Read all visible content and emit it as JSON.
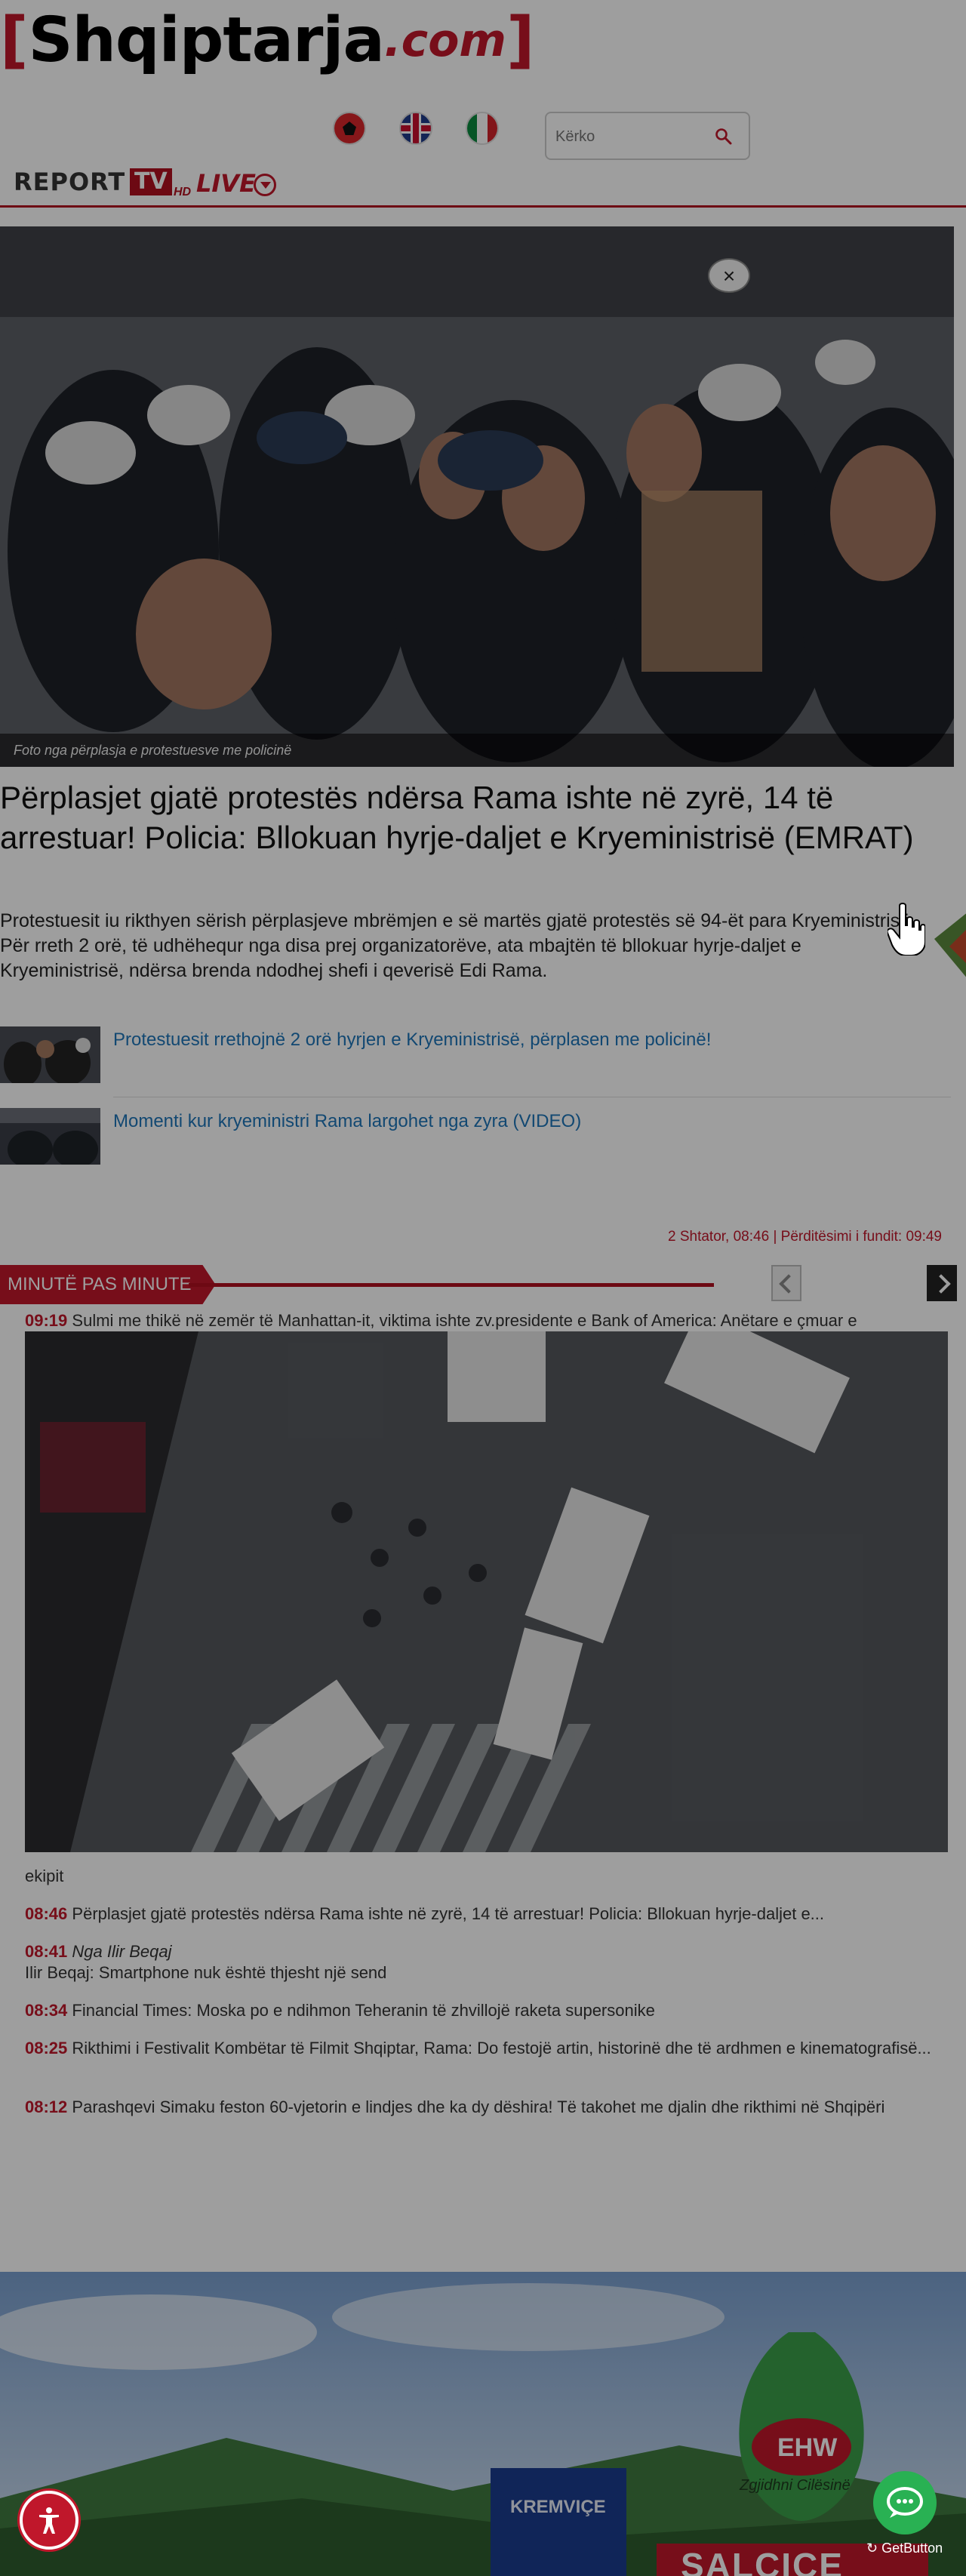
{
  "header": {
    "logo_left_bracket": "[",
    "logo_name": "Shqiptarja",
    "logo_domain": ".com",
    "logo_right_bracket": "]",
    "languages": [
      {
        "code": "sq",
        "icon": "albania-flag-icon"
      },
      {
        "code": "en",
        "icon": "uk-flag-icon"
      },
      {
        "code": "it",
        "icon": "italy-flag-icon"
      }
    ],
    "search_placeholder": "Kërko"
  },
  "live_bar": {
    "report": "REPORT",
    "tv": "TV",
    "hd": "HD",
    "live": "LIVE"
  },
  "article": {
    "photo_caption": "Foto nga përplasja e protestuesve me policinë",
    "close_glyph": "×",
    "headline": "Përplasjet gjatë protestës ndërsa Rama ishte në zyrë, 14 të arrestuar! Policia: Bllokuan hyrje-daljet e Kryeministrisë (EMRAT)",
    "lead": "Protestuesit iu rikthyen sërish përplasjeve mbrëmjen e së martës gjatë protestës së 94-ët para Kryeministrisë. Për rreth 2 orë, të udhëhequr nga disa prej organizatorëve, ata mbajtën të bllokuar hyrje-daljet e Kryeministrisë, ndërsa brenda ndodhej shefi i qeverisë Edi Rama.",
    "related": [
      {
        "title": "Protestuesit rrethojnë 2 orë hyrjen e Kryeministrisë, përplasen me policinë!"
      },
      {
        "title": "Momenti kur kryeministri Rama largohet nga zyra (VIDEO)"
      }
    ],
    "updated": "2 Shtator, 08:46 | Përditësimi i fundit: 09:49"
  },
  "minute": {
    "tag": "MINUTË PAS MINUTE",
    "items": [
      {
        "time": "09:19",
        "text": "Sulmi me thikë në zemër të Manhattan-it, viktima ishte zv.presidente e Bank of America: Anëtare e çmuar e",
        "continuation": "ekipit"
      },
      {
        "time": "08:46",
        "text": "Përplasjet gjatë protestës ndërsa Rama ishte në zyrë, 14 të arrestuar! Policia: Bllokuan hyrje-daljet e..."
      },
      {
        "time": "08:41",
        "author": "Nga Ilir Beqaj",
        "text": "Ilir Beqaj: Smartphone nuk është thjesht një send"
      },
      {
        "time": "08:34",
        "text": "Financial Times: Moska po e ndihmon Teheranin të zhvillojë raketa supersonike"
      },
      {
        "time": "08:25",
        "text": "Rikthimi i Festivalit Kombëtar të Filmit Shqiptar, Rama: Do festojë artin, historinë dhe të ardhmen e kinematografisë..."
      },
      {
        "time": "08:12",
        "text": "Parashqevi Simaku feston 60-vjetorin e lindjes dhe ka dy dëshira! Të takohet me djalin dhe rikthimi në Shqipëri"
      }
    ]
  },
  "ad": {
    "brand": "EHW",
    "tagline": "Zgjidhni Cilësinë",
    "product": "SALCICE",
    "sign": "KREMVIÇE"
  },
  "widgets": {
    "get_button": "GetButton"
  }
}
